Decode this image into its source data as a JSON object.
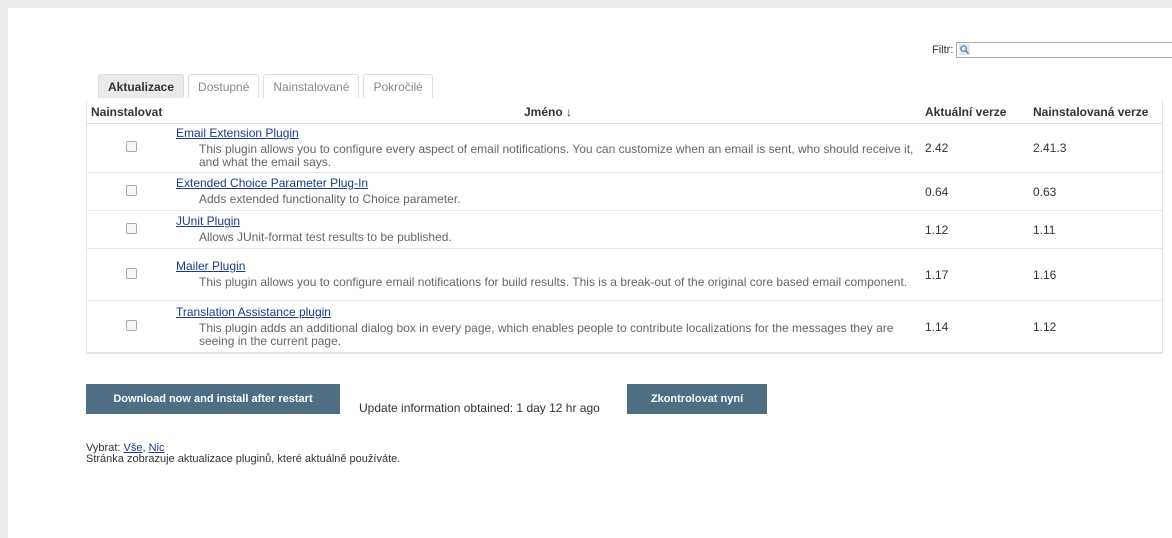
{
  "filter": {
    "label": "Filtr:",
    "value": "",
    "icon": "search-icon"
  },
  "tabs": [
    {
      "label": "Aktualizace",
      "active": true
    },
    {
      "label": "Dostupné",
      "active": false
    },
    {
      "label": "Nainstalované",
      "active": false
    },
    {
      "label": "Pokročilé",
      "active": false
    }
  ],
  "table": {
    "headers": {
      "install": "Nainstalovat",
      "name": "Jméno ↓",
      "current": "Aktuální verze",
      "installed": "Nainstalovaná verze"
    },
    "rows": [
      {
        "name": "Email Extension Plugin",
        "description": "This plugin allows you to configure every aspect of email notifications. You can customize when an email is sent, who should receive it, and what the email says.",
        "current": "2.42",
        "installed": "2.41.3",
        "checked": false
      },
      {
        "name": "Extended Choice Parameter Plug-In",
        "description": "Adds extended functionality to Choice parameter.",
        "current": "0.64",
        "installed": "0.63",
        "checked": false
      },
      {
        "name": "JUnit Plugin",
        "description": "Allows JUnit-format test results to be published.",
        "current": "1.12",
        "installed": "1.11",
        "checked": false
      },
      {
        "name": "Mailer Plugin",
        "description": "This plugin allows you to configure email notifications for build results. This is a break-out of the original core based email component.",
        "current": "1.17",
        "installed": "1.16",
        "checked": false
      },
      {
        "name": "Translation Assistance plugin",
        "description": "This plugin adds an additional dialog box in every page, which enables people to contribute localizations for the messages they are seeing in the current page.",
        "current": "1.14",
        "installed": "1.12",
        "checked": false
      }
    ]
  },
  "actions": {
    "download_label": "Download now and install after restart",
    "update_info": "Update information obtained: 1 day 12 hr ago",
    "check_label": "Zkontrolovat nyní"
  },
  "select": {
    "prefix": "Vybrat:",
    "all": "Vše",
    "separator": ",",
    "none": "Nic"
  },
  "note": "Stránka zobrazuje aktualizace pluginů, které aktuálně používáte.",
  "colors": {
    "button_bg": "#4e6f83",
    "link": "#1a3c8a",
    "page_bg": "#ececec"
  }
}
